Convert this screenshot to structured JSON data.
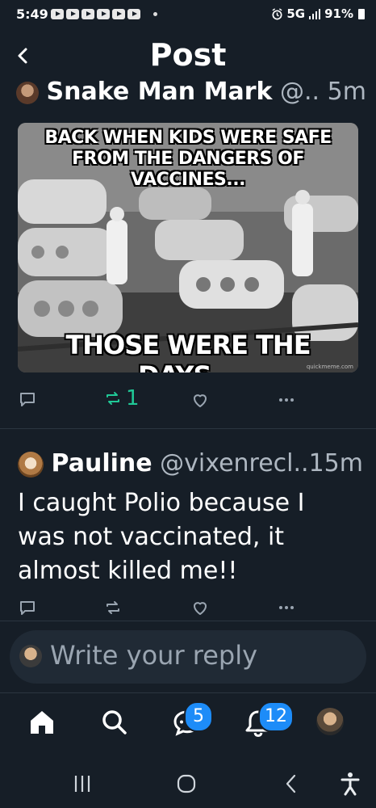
{
  "status_bar": {
    "time": "5:49",
    "network": "5G",
    "battery": "91%"
  },
  "header": {
    "title": "Post"
  },
  "post1": {
    "author_name": "Snake Man Mark",
    "handle": "@..",
    "time": "5m",
    "meme": {
      "top_text": "BACK WHEN KIDS WERE SAFE FROM THE DANGERS OF VACCINES...",
      "bottom_text": "THOSE WERE THE DAYS...",
      "watermark": "quickmeme.com"
    },
    "repost_count": "1"
  },
  "post2": {
    "author_name": "Pauline",
    "handle": "@vixenrecl..",
    "time": "15m",
    "text": "I caught Polio because I was not vaccinated, it almost killed me!!"
  },
  "reply_box": {
    "placeholder": "Write your reply"
  },
  "tab_bar": {
    "chat_badge": "5",
    "notifications_badge": "12"
  },
  "colors": {
    "background": "#161e27",
    "accent": "#1d8cf8",
    "repost_green": "#20c997"
  }
}
